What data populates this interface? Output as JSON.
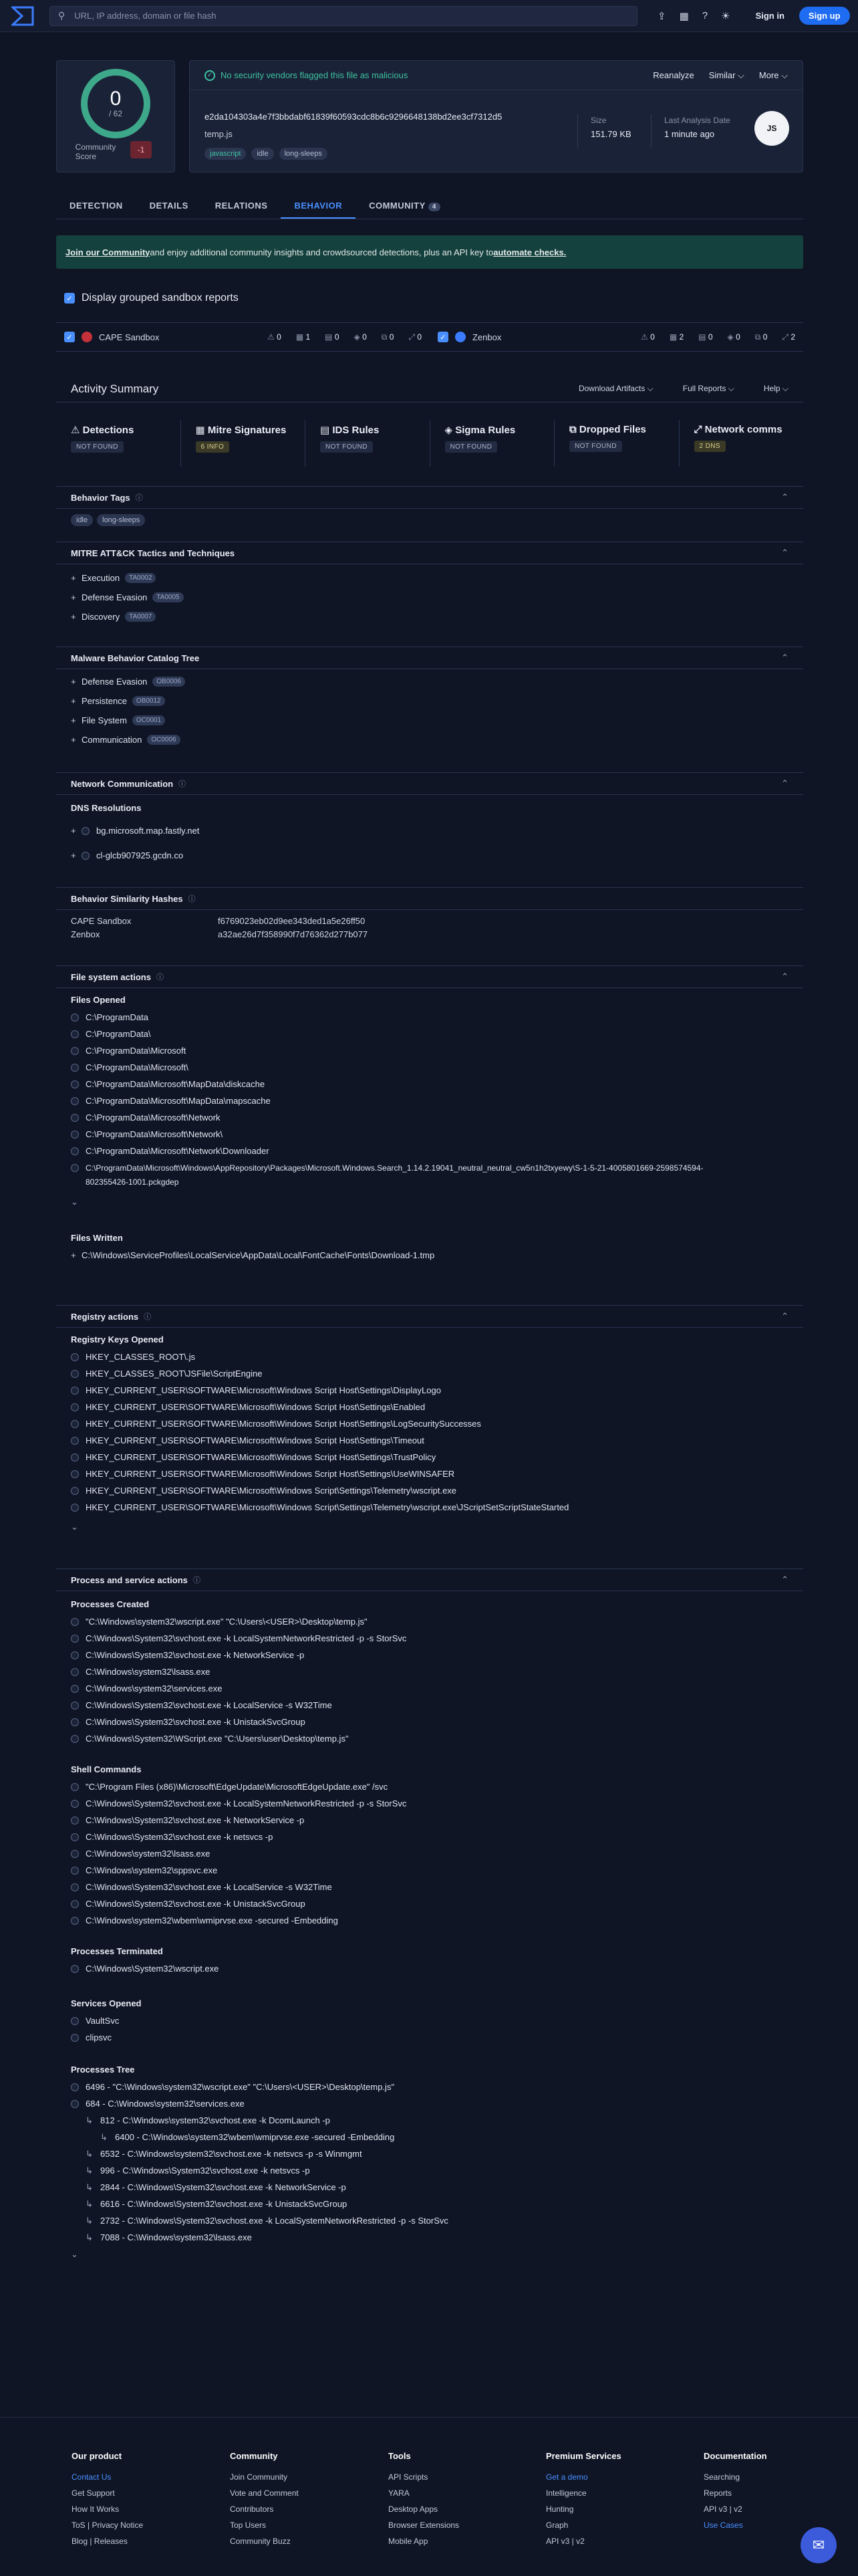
{
  "topbar": {
    "search_placeholder": "URL, IP address, domain or file hash",
    "signin": "Sign in",
    "signup": "Sign up"
  },
  "score": {
    "value": "0",
    "total": "/ 62",
    "label": "Community\nScore",
    "btn": "-1"
  },
  "summary": {
    "ok_msg": "No security vendors flagged this file as malicious",
    "actions": [
      "Reanalyze",
      "Similar ⌵",
      "More ⌵"
    ],
    "hash": "e2da104303a4e7f3bbdabf61839f60593cdc8b6c9296648138bd2ee3cf7312d5",
    "filename": "temp.js",
    "tags": [
      "javascript",
      "idle",
      "long-sleeps"
    ],
    "size_label": "Size",
    "size_value": "151.79 KB",
    "date_label": "Last Analysis Date",
    "date_value": "1 minute ago",
    "fileicon": "JS"
  },
  "tabs": [
    {
      "label": "DETECTION"
    },
    {
      "label": "DETAILS"
    },
    {
      "label": "RELATIONS"
    },
    {
      "label": "BEHAVIOR"
    },
    {
      "label": "COMMUNITY",
      "badge": "4"
    }
  ],
  "banner": {
    "link": "Join our Community",
    "text": " and enjoy additional community insights and crowdsourced detections, plus an API key to ",
    "link2": "automate checks."
  },
  "grouped": "Display grouped sandbox reports",
  "sandboxes": [
    {
      "name": "CAPE Sandbox",
      "counts": [
        "0",
        "1",
        "0",
        "0",
        "0",
        "0"
      ]
    },
    {
      "name": "Zenbox",
      "counts": [
        "0",
        "2",
        "0",
        "0",
        "0",
        "2"
      ]
    }
  ],
  "activity": {
    "title": "Activity Summary",
    "actions": [
      "Download Artifacts ⌵",
      "Full Reports ⌵",
      "Help ⌵"
    ]
  },
  "cards": [
    {
      "t": "Detections",
      "b": "NOT FOUND"
    },
    {
      "t": "Mitre Signatures",
      "b": "6 INFO"
    },
    {
      "t": "IDS Rules",
      "b": "NOT FOUND"
    },
    {
      "t": "Sigma Rules",
      "b": "NOT FOUND"
    },
    {
      "t": "Dropped Files",
      "b": "NOT FOUND"
    },
    {
      "t": "Network comms",
      "b": "2 DNS"
    }
  ],
  "behavior_tags": {
    "title": "Behavior Tags",
    "tags": [
      "idle",
      "long-sleeps"
    ]
  },
  "mitre": {
    "title": "MITRE ATT&CK Tactics and Techniques",
    "items": [
      {
        "l": "Execution",
        "p": "TA0002"
      },
      {
        "l": "Defense Evasion",
        "p": "TA0005"
      },
      {
        "l": "Discovery",
        "p": "TA0007"
      }
    ]
  },
  "mbc": {
    "title": "Malware Behavior Catalog Tree",
    "items": [
      {
        "l": "Defense Evasion",
        "p": "OB0006"
      },
      {
        "l": "Persistence",
        "p": "OB0012"
      },
      {
        "l": "File System",
        "p": "OC0001"
      },
      {
        "l": "Communication",
        "p": "OC0006"
      }
    ]
  },
  "network": {
    "title": "Network Communication",
    "sub": "DNS Resolutions",
    "items": [
      "bg.microsoft.map.fastly.net",
      "cl-glcb907925.gcdn.co"
    ]
  },
  "similarity": {
    "title": "Behavior Similarity Hashes",
    "rows": [
      {
        "k": "CAPE Sandbox",
        "v": "f6769023eb02d9ee343ded1a5e26ff50"
      },
      {
        "k": "Zenbox",
        "v": "a32ae26d7f358990f7d76362d277b077"
      }
    ]
  },
  "files": {
    "title": "File system actions",
    "opened_title": "Files Opened",
    "opened": [
      "C:\\ProgramData",
      "C:\\ProgramData\\",
      "C:\\ProgramData\\Microsoft",
      "C:\\ProgramData\\Microsoft\\",
      "C:\\ProgramData\\Microsoft\\MapData\\diskcache",
      "C:\\ProgramData\\Microsoft\\MapData\\mapscache",
      "C:\\ProgramData\\Microsoft\\Network",
      "C:\\ProgramData\\Microsoft\\Network\\",
      "C:\\ProgramData\\Microsoft\\Network\\Downloader",
      "C:\\ProgramData\\Microsoft\\Windows\\AppRepository\\Packages\\Microsoft.Windows.Search_1.14.2.19041_neutral_neutral_cw5n1h2txyewy\\S-1-5-21-4005801669-2598574594-",
      "802355426-1001.pckgdep"
    ],
    "written_title": "Files Written",
    "written": [
      "C:\\Windows\\ServiceProfiles\\LocalService\\AppData\\Local\\FontCache\\Fonts\\Download-1.tmp"
    ]
  },
  "registry": {
    "title": "Registry actions",
    "sub": "Registry Keys Opened",
    "items": [
      "HKEY_CLASSES_ROOT\\.js",
      "HKEY_CLASSES_ROOT\\JSFile\\ScriptEngine",
      "HKEY_CURRENT_USER\\SOFTWARE\\Microsoft\\Windows Script Host\\Settings\\DisplayLogo",
      "HKEY_CURRENT_USER\\SOFTWARE\\Microsoft\\Windows Script Host\\Settings\\Enabled",
      "HKEY_CURRENT_USER\\SOFTWARE\\Microsoft\\Windows Script Host\\Settings\\LogSecuritySuccesses",
      "HKEY_CURRENT_USER\\SOFTWARE\\Microsoft\\Windows Script Host\\Settings\\Timeout",
      "HKEY_CURRENT_USER\\SOFTWARE\\Microsoft\\Windows Script Host\\Settings\\TrustPolicy",
      "HKEY_CURRENT_USER\\SOFTWARE\\Microsoft\\Windows Script Host\\Settings\\UseWINSAFER",
      "HKEY_CURRENT_USER\\SOFTWARE\\Microsoft\\Windows Script\\Settings\\Telemetry\\wscript.exe",
      "HKEY_CURRENT_USER\\SOFTWARE\\Microsoft\\Windows Script\\Settings\\Telemetry\\wscript.exe\\JScriptSetScriptStateStarted"
    ]
  },
  "process": {
    "title": "Process and service actions",
    "created_title": "Processes Created",
    "created": [
      "\"C:\\Windows\\system32\\wscript.exe\" \"C:\\Users\\<USER>\\Desktop\\temp.js\"",
      "C:\\Windows\\System32\\svchost.exe -k LocalSystemNetworkRestricted -p -s StorSvc",
      "C:\\Windows\\System32\\svchost.exe -k NetworkService -p",
      "C:\\Windows\\system32\\lsass.exe",
      "C:\\Windows\\system32\\services.exe",
      "C:\\Windows\\System32\\svchost.exe -k LocalService -s W32Time",
      "C:\\Windows\\System32\\svchost.exe -k UnistackSvcGroup",
      "C:\\Windows\\System32\\WScript.exe \"C:\\Users\\user\\Desktop\\temp.js\""
    ],
    "shell_title": "Shell Commands",
    "shell": [
      "\"C:\\Program Files (x86)\\Microsoft\\EdgeUpdate\\MicrosoftEdgeUpdate.exe\" /svc",
      "C:\\Windows\\System32\\svchost.exe -k LocalSystemNetworkRestricted -p -s StorSvc",
      "C:\\Windows\\System32\\svchost.exe -k NetworkService -p",
      "C:\\Windows\\System32\\svchost.exe -k netsvcs -p",
      "C:\\Windows\\system32\\lsass.exe",
      "C:\\Windows\\system32\\sppsvc.exe",
      "C:\\Windows\\System32\\svchost.exe -k LocalService -s W32Time",
      "C:\\Windows\\System32\\svchost.exe -k UnistackSvcGroup",
      "C:\\Windows\\system32\\wbem\\wmiprvse.exe -secured -Embedding"
    ],
    "term_title": "Processes Terminated",
    "term": [
      "C:\\Windows\\System32\\wscript.exe"
    ],
    "svc_title": "Services Opened",
    "svc": [
      "VaultSvc",
      "clipsvc"
    ],
    "tree_title": "Processes Tree",
    "tree": [
      {
        "d": 0,
        "t": "6496 - \"C:\\Windows\\system32\\wscript.exe\" \"C:\\Users\\<USER>\\Desktop\\temp.js\""
      },
      {
        "d": 0,
        "t": "684 - C:\\Windows\\system32\\services.exe"
      },
      {
        "d": 1,
        "t": "812 - C:\\Windows\\system32\\svchost.exe -k DcomLaunch -p"
      },
      {
        "d": 2,
        "t": "6400 - C:\\Windows\\system32\\wbem\\wmiprvse.exe -secured -Embedding"
      },
      {
        "d": 1,
        "t": "6532 - C:\\Windows\\system32\\svchost.exe -k netsvcs -p -s Winmgmt"
      },
      {
        "d": 1,
        "t": "996 - C:\\Windows\\System32\\svchost.exe -k netsvcs -p"
      },
      {
        "d": 1,
        "t": "2844 - C:\\Windows\\System32\\svchost.exe -k NetworkService -p"
      },
      {
        "d": 1,
        "t": "6616 - C:\\Windows\\System32\\svchost.exe -k UnistackSvcGroup"
      },
      {
        "d": 1,
        "t": "2732 - C:\\Windows\\System32\\svchost.exe -k LocalSystemNetworkRestricted -p -s StorSvc"
      },
      {
        "d": 1,
        "t": "7088 - C:\\Windows\\system32\\lsass.exe"
      }
    ]
  },
  "footer": [
    {
      "h": "Our product",
      "i": [
        "Contact Us",
        "Get Support",
        "How It Works",
        "ToS | Privacy Notice",
        "Blog | Releases"
      ]
    },
    {
      "h": "Community",
      "i": [
        "Join Community",
        "Vote and Comment",
        "Contributors",
        "Top Users",
        "Community Buzz"
      ]
    },
    {
      "h": "Tools",
      "i": [
        "API Scripts",
        "YARA",
        "Desktop Apps",
        "Browser Extensions",
        "Mobile App"
      ]
    },
    {
      "h": "Premium Services",
      "i": [
        "Get a demo",
        "Intelligence",
        "Hunting",
        "Graph",
        "API v3 | v2"
      ]
    },
    {
      "h": "Documentation",
      "i": [
        "Searching",
        "Reports",
        "API v3 | v2",
        "Use Cases"
      ]
    }
  ]
}
